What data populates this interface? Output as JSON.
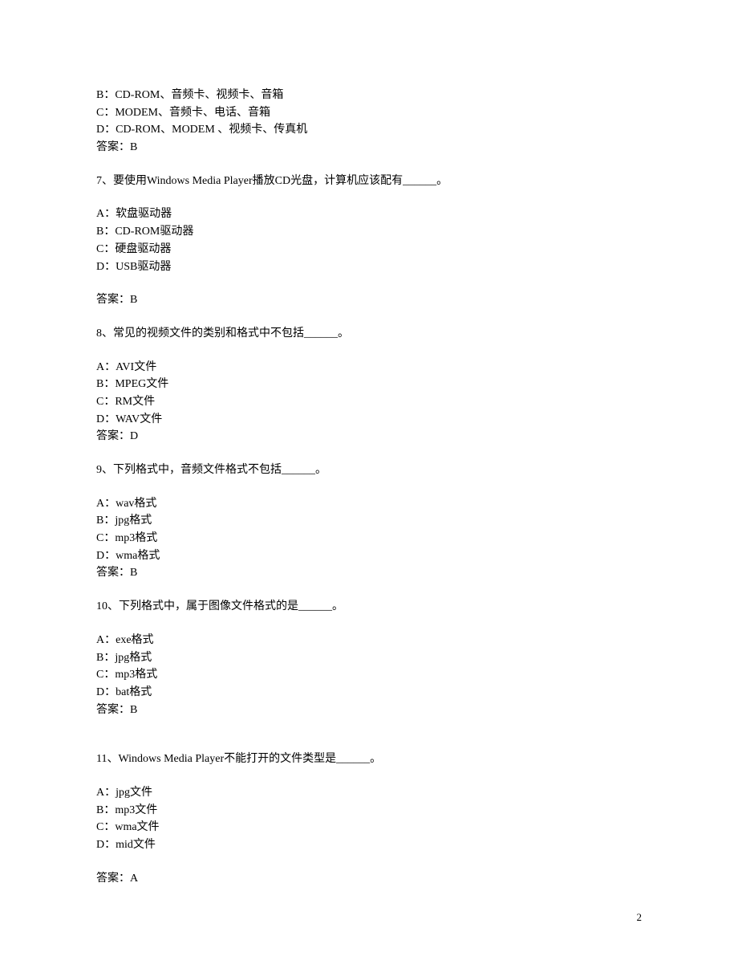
{
  "intro": {
    "opt_b": "B：CD-ROM、音频卡、视频卡、音箱",
    "opt_c": "C：MODEM、音频卡、电话、音箱",
    "opt_d": "D：CD-ROM、MODEM 、视频卡、传真机",
    "answer": "答案：B"
  },
  "q7": {
    "question": "7、要使用Windows Media Player播放CD光盘，计算机应该配有______。",
    "opt_a": "A：软盘驱动器",
    "opt_b": "B：CD-ROM驱动器",
    "opt_c": "C：硬盘驱动器",
    "opt_d": "D：USB驱动器",
    "answer": "答案：B"
  },
  "q8": {
    "question": "8、常见的视频文件的类别和格式中不包括______。",
    "opt_a": "A：AVI文件",
    "opt_b": "B：MPEG文件",
    "opt_c": "C：RM文件",
    "opt_d": "D：WAV文件",
    "answer": "答案：D"
  },
  "q9": {
    "question": "9、下列格式中，音频文件格式不包括______。",
    "opt_a": "A：wav格式",
    "opt_b": "B：jpg格式",
    "opt_c": "C：mp3格式",
    "opt_d": "D：wma格式",
    "answer": "答案：B"
  },
  "q10": {
    "question": "10、下列格式中，属于图像文件格式的是______。",
    "opt_a": "A：exe格式",
    "opt_b": "B：jpg格式",
    "opt_c": "C：mp3格式",
    "opt_d": "D：bat格式",
    "answer": "答案：B"
  },
  "q11": {
    "question": "11、Windows Media Player不能打开的文件类型是______。",
    "opt_a": "A：jpg文件",
    "opt_b": "B：mp3文件",
    "opt_c": "C：wma文件",
    "opt_d": "D：mid文件",
    "answer": "答案：A"
  },
  "page_number": "2"
}
